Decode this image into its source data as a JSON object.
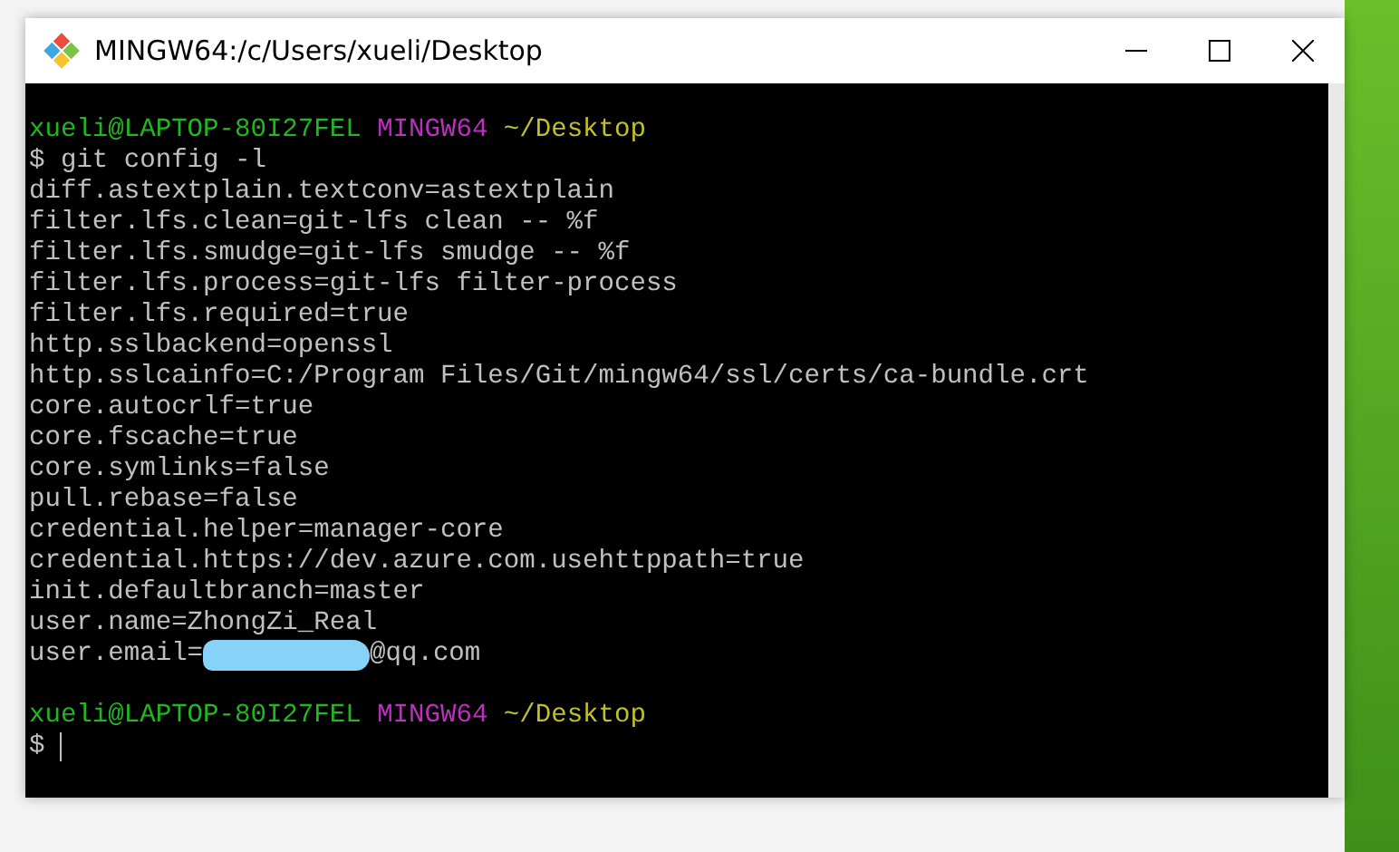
{
  "window": {
    "title": "MINGW64:/c/Users/xueli/Desktop"
  },
  "terminal": {
    "lines": [
      {
        "kind": "prompt",
        "user_host": "xueli@LAPTOP-80I27FEL",
        "system": "MINGW64",
        "path": "~/Desktop"
      },
      {
        "kind": "text",
        "text": "$ git config -l"
      },
      {
        "kind": "text",
        "text": "diff.astextplain.textconv=astextplain"
      },
      {
        "kind": "text",
        "text": "filter.lfs.clean=git-lfs clean -- %f"
      },
      {
        "kind": "text",
        "text": "filter.lfs.smudge=git-lfs smudge -- %f"
      },
      {
        "kind": "text",
        "text": "filter.lfs.process=git-lfs filter-process"
      },
      {
        "kind": "text",
        "text": "filter.lfs.required=true"
      },
      {
        "kind": "text",
        "text": "http.sslbackend=openssl"
      },
      {
        "kind": "text",
        "text": "http.sslcainfo=C:/Program Files/Git/mingw64/ssl/certs/ca-bundle.crt"
      },
      {
        "kind": "text",
        "text": "core.autocrlf=true"
      },
      {
        "kind": "text",
        "text": "core.fscache=true"
      },
      {
        "kind": "text",
        "text": "core.symlinks=false"
      },
      {
        "kind": "text",
        "text": "pull.rebase=false"
      },
      {
        "kind": "text",
        "text": "credential.helper=manager-core"
      },
      {
        "kind": "text",
        "text": "credential.https://dev.azure.com.usehttppath=true"
      },
      {
        "kind": "text",
        "text": "init.defaultbranch=master"
      },
      {
        "kind": "text",
        "text": "user.name=ZhongZi_Real"
      },
      {
        "kind": "redacted",
        "before": "user.email=",
        "after": "@qq.com"
      },
      {
        "kind": "blank"
      },
      {
        "kind": "prompt",
        "user_host": "xueli@LAPTOP-80I27FEL",
        "system": "MINGW64",
        "path": "~/Desktop"
      },
      {
        "kind": "input",
        "text": "$"
      }
    ]
  }
}
